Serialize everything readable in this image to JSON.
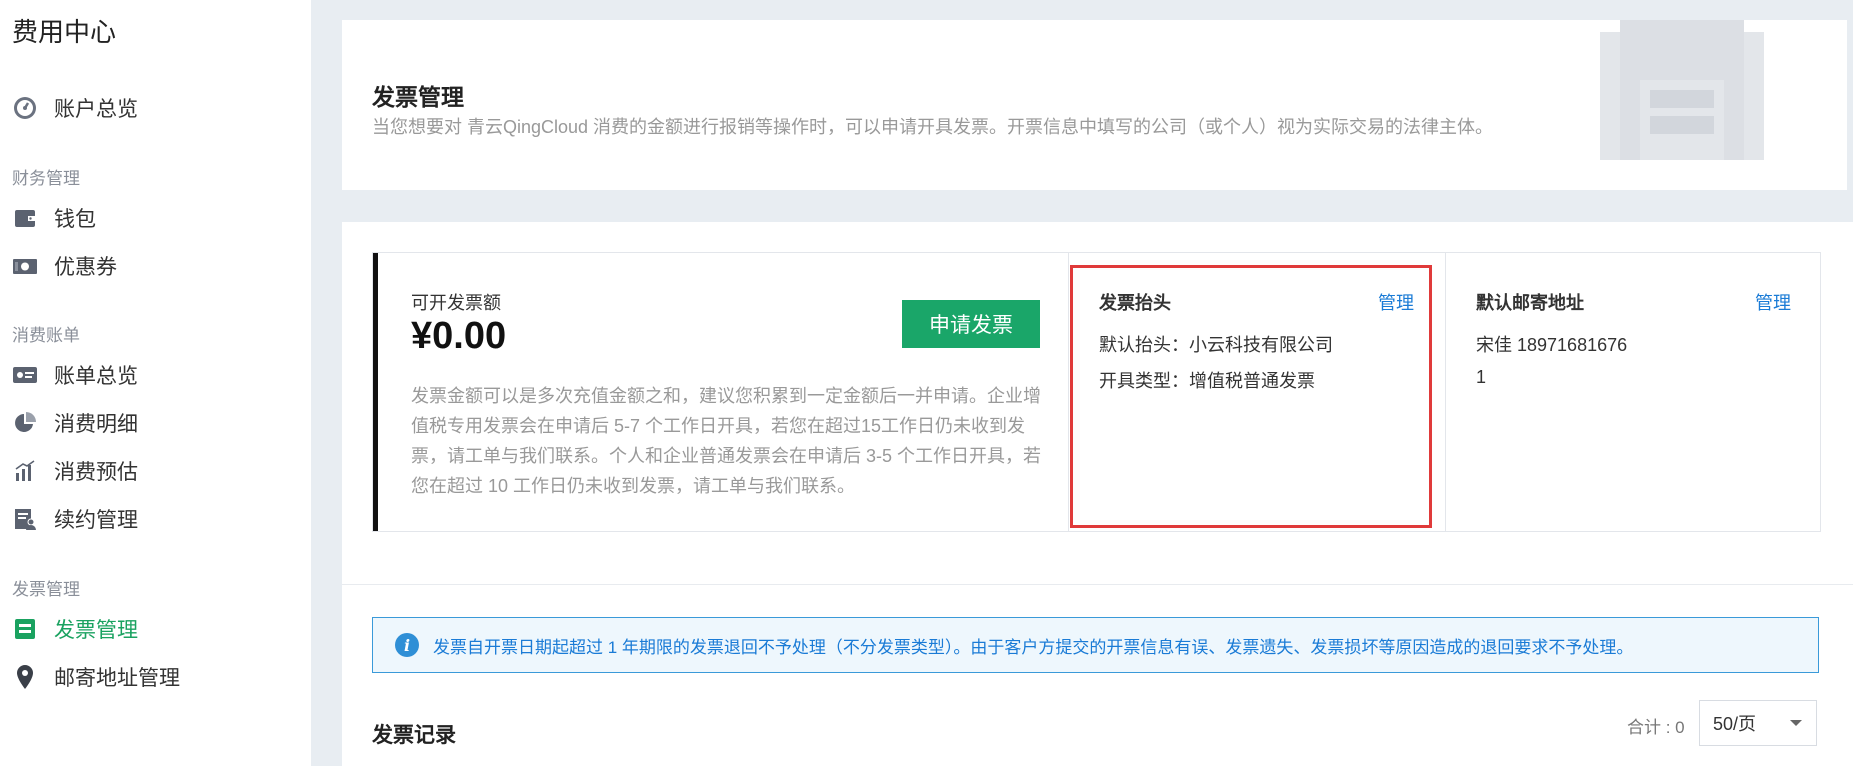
{
  "sidebar": {
    "app_title": "费用中心",
    "overview": "账户总览",
    "group_finance": "财务管理",
    "wallet": "钱包",
    "coupons": "优惠券",
    "group_billing": "消费账单",
    "bill_overview": "账单总览",
    "consumption_detail": "消费明细",
    "consumption_estimate": "消费预估",
    "renewal": "续约管理",
    "group_invoice": "发票管理",
    "invoice_mgmt": "发票管理",
    "mailing_address": "邮寄地址管理"
  },
  "header": {
    "title": "发票管理",
    "description": "当您想要对 青云QingCloud 消费的金额进行报销等操作时，可以申请开具发票。开票信息中填写的公司（或个人）视为实际交易的法律主体。"
  },
  "amount_card": {
    "label": "可开发票额",
    "amount": "¥0.00",
    "apply_button": "申请发票",
    "note": "发票金额可以是多次充值金额之和，建议您积累到一定金额后一并申请。企业增值税专用发票会在申请后 5-7 个工作日开具，若您在超过15工作日仍未收到发票，请工单与我们联系。个人和企业普通发票会在申请后 3-5 个工作日开具，若您在超过 10 工作日仍未收到发票，请工单与我们联系。"
  },
  "header_card": {
    "title": "发票抬头",
    "manage": "管理",
    "default_header": "默认抬头：小云科技有限公司",
    "invoice_type": "开具类型：增值税普通发票"
  },
  "address_card": {
    "title": "默认邮寄地址",
    "manage": "管理",
    "contact": "宋佳 18971681676",
    "address": "1"
  },
  "alert": {
    "icon": "info-icon",
    "text": "发票自开票日期起超过 1 年期限的发票退回不予处理（不分发票类型）。由于客户方提交的开票信息有误、发票遗失、发票损坏等原因造成的退回要求不予处理。"
  },
  "records": {
    "title": "发票记录",
    "total": "合计 : 0",
    "page_size": "50/页"
  },
  "colors": {
    "accent_green": "#1aa669",
    "link_blue": "#1a7bd6",
    "highlight_red": "#e03a3a"
  }
}
